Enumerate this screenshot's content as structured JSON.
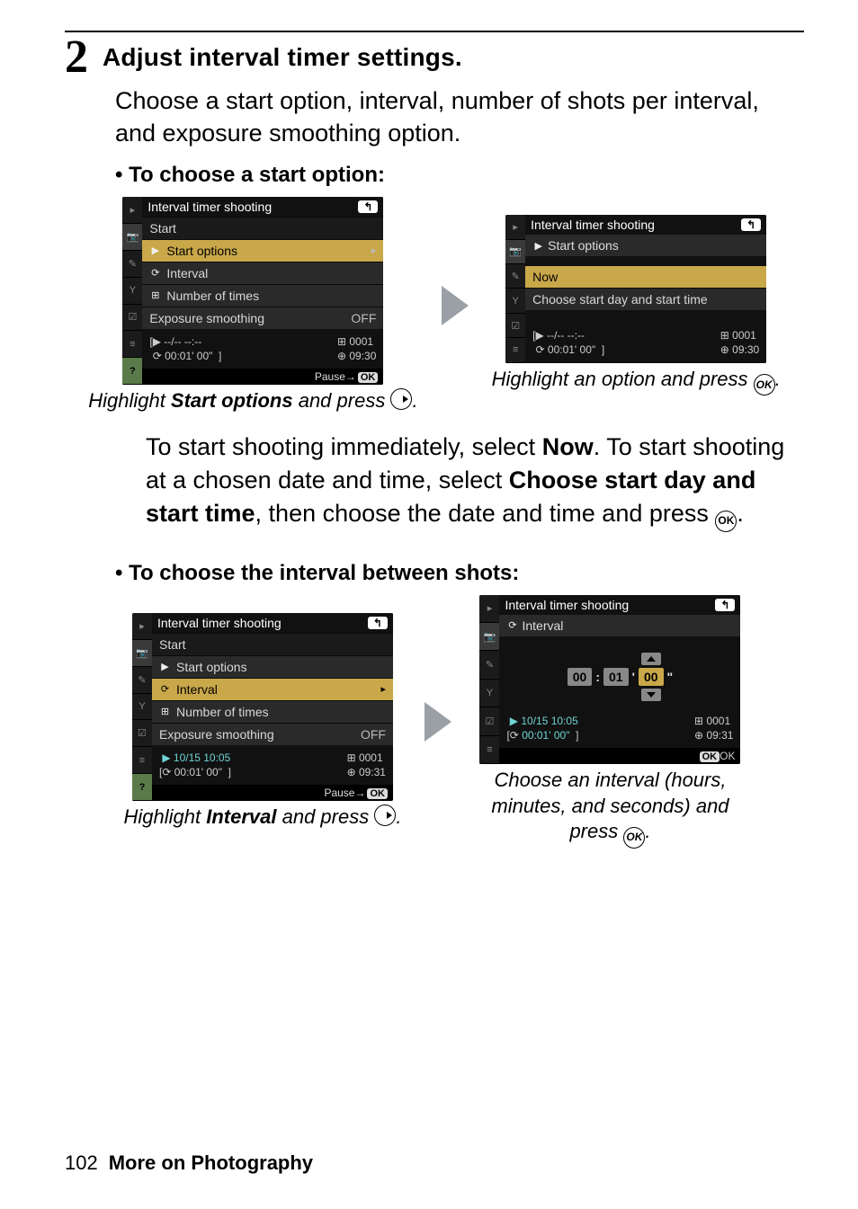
{
  "step": {
    "number": "2",
    "title": "Adjust interval timer settings."
  },
  "intro": "Choose a start option, interval, number of shots per interval, and exposure smoothing option.",
  "bullet1": "To choose a start option:",
  "bullet2": "To choose the interval between shots:",
  "lcd": {
    "header": "Interval timer shooting",
    "back": "↰",
    "rows": {
      "start": "Start",
      "start_options": "Start options",
      "interval": "Interval",
      "num_times": "Number of times",
      "exp_smooth": "Exposure smoothing",
      "off": "OFF",
      "now": "Now",
      "choose_day": "Choose start day and start time"
    },
    "info_a": {
      "l1": "--/-- --:--",
      "l2": "00:01' 00\"",
      "r1": "0001",
      "r2": "09:30"
    },
    "info_b": {
      "l1": "10/15 10:05",
      "l2": "00:01' 00\"",
      "r1": "0001",
      "r2": "09:31"
    },
    "pause": "Pause→",
    "okok": "OK",
    "spinner": {
      "h": "00",
      "m": "01",
      "s": "00"
    }
  },
  "cap": {
    "a": {
      "pre": "Highlight ",
      "bold": "Start options",
      "post": " and press "
    },
    "b": "Highlight an option and press ",
    "c": {
      "pre": "Highlight ",
      "bold": "Interval",
      "post": " and press "
    },
    "d": "Choose an interval (hours, minutes, and seconds) and press "
  },
  "para": {
    "p1a": "To start shooting immediately, select ",
    "p1b": "Now",
    "p1c": ".  To start shooting at a chosen date and time, select ",
    "p1d": "Choose start day and start time",
    "p1e": ", then choose the date and time and press "
  },
  "footer": {
    "page": "102",
    "section": "More on Photography"
  }
}
